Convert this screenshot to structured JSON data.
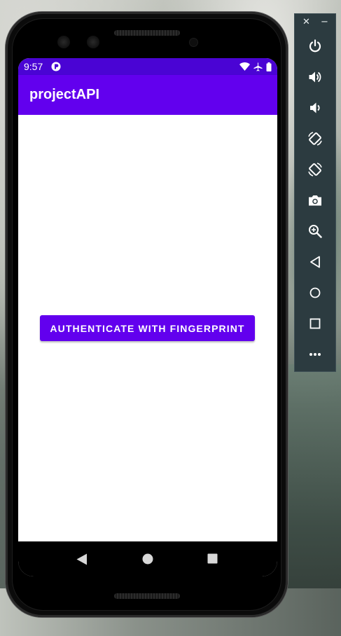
{
  "status_bar": {
    "time": "9:57"
  },
  "app": {
    "title": "projectAPI",
    "primary_color": "#6200ee",
    "status_bar_color": "#4a04d4"
  },
  "main": {
    "authenticate_button": "AUTHENTICATE WITH FINGERPRINT"
  },
  "emulator_toolbar": {
    "close_label": "✕",
    "minimize_label": "−",
    "buttons": [
      {
        "icon": "power-icon"
      },
      {
        "icon": "volume-up-icon"
      },
      {
        "icon": "volume-down-icon"
      },
      {
        "icon": "rotate-left-icon"
      },
      {
        "icon": "rotate-right-icon"
      },
      {
        "icon": "camera-icon"
      },
      {
        "icon": "zoom-icon"
      },
      {
        "icon": "back-icon"
      },
      {
        "icon": "home-icon"
      },
      {
        "icon": "overview-icon"
      },
      {
        "icon": "more-icon"
      }
    ]
  },
  "nav_bar": {
    "icons": [
      "back-icon",
      "home-icon",
      "recents-icon"
    ]
  }
}
